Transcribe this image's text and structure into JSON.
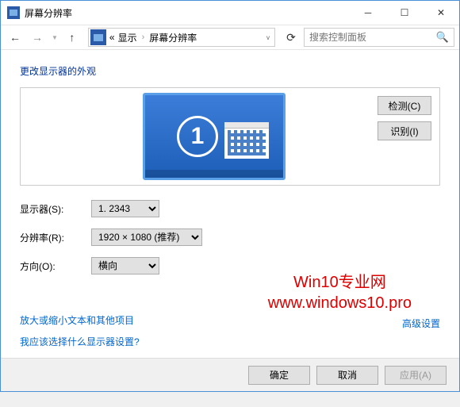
{
  "title": "屏幕分辨率",
  "breadcrumb": {
    "pre": "«",
    "mid": "显示",
    "current": "屏幕分辨率"
  },
  "search_placeholder": "搜索控制面板",
  "page_heading": "更改显示器的外观",
  "side_buttons": {
    "detect": "检测(C)",
    "identify": "识别(I)"
  },
  "monitor_number": "1",
  "form": {
    "display_label": "显示器(S):",
    "display_value": "1. 2343",
    "resolution_label": "分辨率(R):",
    "resolution_value": "1920 × 1080 (推荐)",
    "orientation_label": "方向(O):",
    "orientation_value": "横向"
  },
  "watermark": {
    "line1": "Win10专业网",
    "line2": "www.windows10.pro"
  },
  "links": {
    "advanced": "高级设置",
    "textsize": "放大或缩小文本和其他项目",
    "which": "我应该选择什么显示器设置?"
  },
  "footer": {
    "ok": "确定",
    "cancel": "取消",
    "apply": "应用(A)"
  }
}
